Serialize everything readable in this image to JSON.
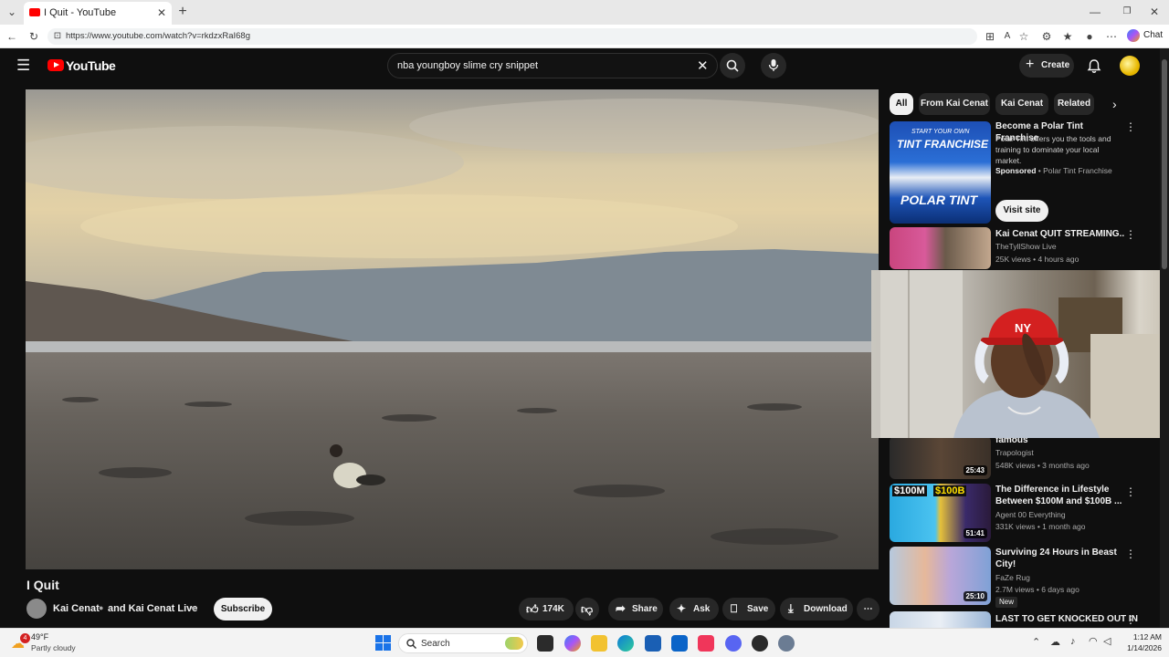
{
  "browser": {
    "tab_title": "I Quit - YouTube",
    "new_tab": "+",
    "url": "https://www.youtube.com/watch?v=rkdzxRaI68g",
    "chat_label": "Chat"
  },
  "header": {
    "logo_text": "YouTube",
    "search_value": "nba youngboy slime cry snippet",
    "create_label": "Create"
  },
  "video": {
    "title": "I Quit",
    "channel": "Kai Cenat",
    "channel_joiner": "and Kai Cenat Live",
    "subscribe_label": "Subscribe",
    "likes": "174K",
    "share_label": "Share",
    "ask_label": "Ask",
    "save_label": "Save",
    "download_label": "Download"
  },
  "chips": [
    "All",
    "From Kai Cenat",
    "Kai Cenat",
    "Related"
  ],
  "recommendations": [
    {
      "title": "Become a Polar Tint Franchise",
      "desc": "Polar Tint offers you the tools and training to dominate your local market.",
      "sponsored": "Sponsored",
      "advertiser": "Polar Tint Franchise",
      "cta": "Visit site",
      "thumb_top": "START YOUR OWN",
      "thumb_main": "TINT FRANCHISE",
      "thumb_brand": "POLAR TINT"
    },
    {
      "title": "Kai Cenat QUIT STREAMING..",
      "channel": "TheTyllShow Live",
      "meta": "25K views • 4 hours ago"
    },
    {
      "title": "famous",
      "channel": "Trapologist",
      "meta": "548K views • 3 months ago",
      "duration": "25:43"
    },
    {
      "title": "The Difference in Lifestyle Between $100M and $100B ...",
      "channel": "Agent 00 Everything",
      "meta": "331K views • 1 month ago",
      "duration": "51:41",
      "thumb_a": "$100M",
      "thumb_b": "$100B"
    },
    {
      "title": "Surviving 24 Hours in Beast City!",
      "channel": "FaZe Rug",
      "meta": "2.7M views • 6 days ago",
      "badge": "New",
      "duration": "25:10"
    },
    {
      "title": "LAST TO GET KNOCKED OUT IN"
    }
  ],
  "webcam": {
    "cap_text": "NY"
  },
  "taskbar": {
    "weather_temp": "49°F",
    "weather_desc": "Partly cloudy",
    "weather_badge": "4",
    "search_label": "Search",
    "time": "1:12 AM",
    "date": "1/14/2026"
  },
  "colors": {
    "youtube_red": "#ff0000",
    "dark_bg": "#0f0f0f",
    "chip_bg": "#272727"
  }
}
